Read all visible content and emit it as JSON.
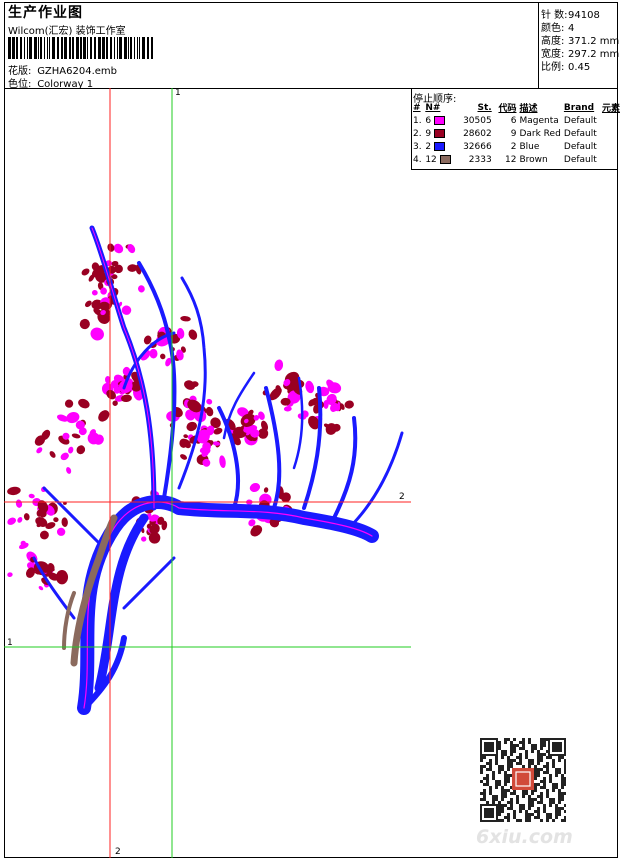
{
  "header": {
    "title": "生产作业图",
    "studio": "Wilcom(汇宏) 装饰工作室",
    "design_label": "花版:",
    "design_value": "GZHA6204.emb",
    "colorway_label": "色位:",
    "colorway_value": "Colorway 1"
  },
  "specs": [
    {
      "label": "针 数:",
      "value": "94108"
    },
    {
      "label": "颜色:",
      "value": "4"
    },
    {
      "label": "高度:",
      "value": "371.2 mm"
    },
    {
      "label": "宽度:",
      "value": "297.2 mm"
    },
    {
      "label": "比例:",
      "value": "0.45"
    }
  ],
  "color_table": {
    "title": "停止顺序:",
    "headers": [
      "#",
      "N#",
      "St.",
      "代码",
      "描述",
      "Brand",
      "元素"
    ],
    "rows": [
      {
        "idx": "1.",
        "n": "6",
        "stitches": "30505",
        "code": "6",
        "desc": "Magenta",
        "brand": "Default",
        "color": "#ff00ff"
      },
      {
        "idx": "2.",
        "n": "9",
        "stitches": "28602",
        "code": "9",
        "desc": "Dark Red",
        "brand": "Default",
        "color": "#990022"
      },
      {
        "idx": "3.",
        "n": "2",
        "stitches": "32666",
        "code": "2",
        "desc": "Blue",
        "brand": "Default",
        "color": "#1a1aff"
      },
      {
        "idx": "4.",
        "n": "12",
        "stitches": "2333",
        "code": "12",
        "desc": "Brown",
        "brand": "Default",
        "color": "#8b6a5e"
      }
    ]
  },
  "guides": {
    "v_green": "1",
    "h_red": "2",
    "h_green": "1",
    "v_red": "2"
  },
  "watermark": "6xiu.com"
}
